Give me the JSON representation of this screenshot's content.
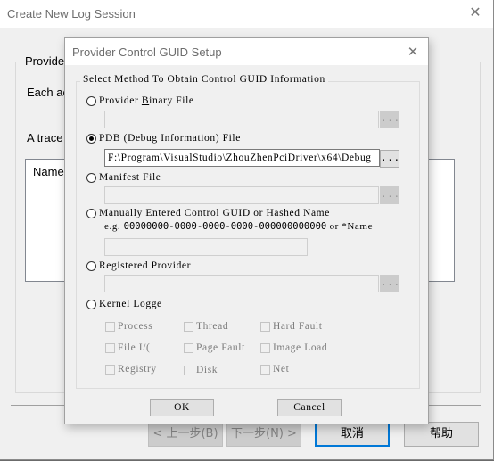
{
  "parent_dialog": {
    "title": "Create New Log Session",
    "close_icon": "close-icon",
    "group_label": "Provider",
    "description_line1": "Each ac",
    "description_line2": "A trace",
    "list_header_name": "Name",
    "buttons": {
      "back": "< 上一步(B)",
      "next": "下一步(N) >",
      "cancel": "取消",
      "help": "帮助"
    }
  },
  "child_dialog": {
    "title": "Provider Control GUID Setup",
    "close_icon": "close-icon",
    "group_label": "Select Method To Obtain Control GUID Information",
    "options": {
      "binary": {
        "label_pre": "Provider ",
        "label_u": "B",
        "label_post": "inary File",
        "checked": false,
        "value": "",
        "browse_label": "..."
      },
      "pdb": {
        "label": "PDB (Debug Information) File",
        "checked": true,
        "value": "F:\\Program\\VisualStudio\\ZhouZhenPciDriver\\x64\\Debug",
        "browse_label": "..."
      },
      "manifest": {
        "label": "Manifest File",
        "checked": false,
        "value": "",
        "browse_label": "..."
      },
      "manual": {
        "label": "Manually Entered Control GUID or Hashed Name",
        "hint_prefix": "e.g. ",
        "hint_guid": "00000000-0000-0000-0000-000000000000",
        "hint_suffix": " or *Name",
        "checked": false,
        "value": ""
      },
      "registered": {
        "label": "Registered Provider",
        "checked": false,
        "value": "",
        "browse_label": "..."
      },
      "kernel": {
        "label": "Kernel Logge",
        "checked": false
      }
    },
    "kernel_flags": [
      {
        "label": "Process",
        "checked": false
      },
      {
        "label": "Thread",
        "checked": false
      },
      {
        "label": "Hard Fault",
        "checked": false
      },
      {
        "label": "File I/(",
        "checked": false
      },
      {
        "label": "Page Fault",
        "checked": false
      },
      {
        "label": "Image Load",
        "checked": false
      },
      {
        "label": "Registry",
        "checked": false
      },
      {
        "label": "Disk",
        "checked": false
      },
      {
        "label": "Net",
        "checked": false
      }
    ],
    "ok_label": "OK",
    "cancel_label": "Cancel"
  }
}
